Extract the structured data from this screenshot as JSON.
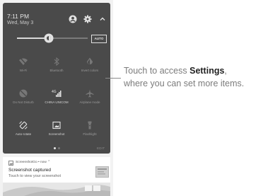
{
  "status": {
    "time": "7:11 PM",
    "date": "Wed, May 3"
  },
  "header_icons": [
    "account-icon",
    "gear-icon",
    "chevron-up-icon"
  ],
  "brightness": {
    "level": 0.45,
    "auto_label": "AUTO"
  },
  "tiles": [
    {
      "label": "Wi-Fi",
      "icon": "wifi-off-icon",
      "active": false
    },
    {
      "label": "Bluetooth",
      "icon": "bluetooth-icon",
      "active": false
    },
    {
      "label": "Invert colors",
      "icon": "invert-colors-icon",
      "active": false
    },
    {
      "label": "Do Not Disturb",
      "icon": "do-not-disturb-icon",
      "active": false
    },
    {
      "label": "CHINA UNICOM",
      "icon": "signal-icon",
      "active": true
    },
    {
      "label": "Airplane mode",
      "icon": "airplane-icon",
      "active": false
    },
    {
      "label": "Auto-rotate",
      "icon": "auto-rotate-icon",
      "active": true
    },
    {
      "label": "Screenshot",
      "icon": "screenshot-icon",
      "active": true
    },
    {
      "label": "Flashlight",
      "icon": "flashlight-icon",
      "active": false
    }
  ],
  "edit_label": "EDIT",
  "page_indicator": {
    "pages": 2,
    "current": 1
  },
  "notification": {
    "app_line": "ScreenshotGo • now ⌃",
    "title": "Screenshot captured",
    "body": "Touch to view your screenshot"
  },
  "callout": {
    "prefix": "Touch to access ",
    "bold": "Settings",
    "suffix": ",",
    "line2": "where you can set more items."
  },
  "colors": {
    "panel": "#4a4a4a",
    "active_icon": "#e6e6e6",
    "inactive_icon": "#777777",
    "callout_text": "#7c7c7c"
  }
}
